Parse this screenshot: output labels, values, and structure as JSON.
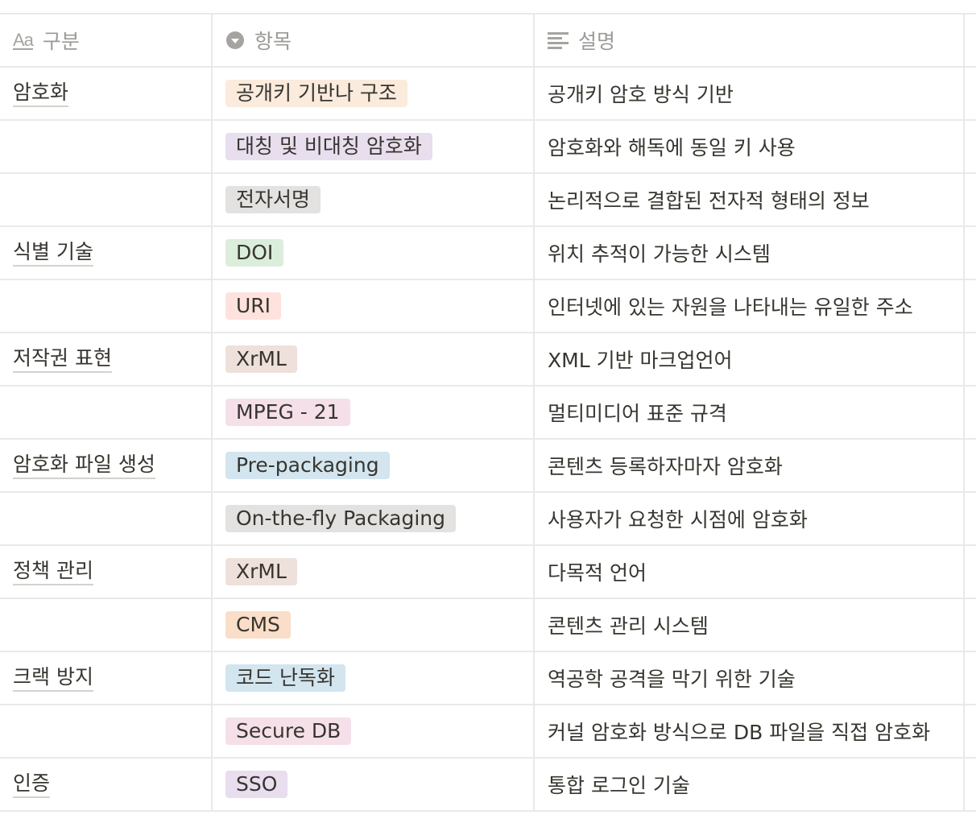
{
  "header": {
    "col_name": "구분",
    "col_item": "항목",
    "col_desc": "설명",
    "col_name_icon": "text-property-icon",
    "col_item_icon": "select-property-icon",
    "col_desc_icon": "paragraph-property-icon"
  },
  "rows": [
    {
      "name": "암호화",
      "tag": "공개키 기반나 구조",
      "tag_color": "#faebdd",
      "desc": "공개키 암호 방식 기반"
    },
    {
      "name": "",
      "tag": "대칭 및 비대칭 암호화",
      "tag_color": "#e8deee",
      "desc": "암호화와 해독에 동일 키 사용"
    },
    {
      "name": "",
      "tag": "전자서명",
      "tag_color": "#e3e2e0",
      "desc": "논리적으로 결합된 전자적 형태의 정보"
    },
    {
      "name": "식별 기술",
      "tag": "DOI",
      "tag_color": "#dbeddb",
      "desc": "위치 추적이 가능한 시스템"
    },
    {
      "name": "",
      "tag": "URI",
      "tag_color": "#ffe2dd",
      "desc": "인터넷에 있는 자원을 나타내는 유일한 주소"
    },
    {
      "name": "저작권 표현",
      "tag": "XrML",
      "tag_color": "#eee0da",
      "desc": "XML 기반 마크업언어"
    },
    {
      "name": "",
      "tag": "MPEG - 21",
      "tag_color": "#f5e0e9",
      "desc": "멀티미디어 표준 규격"
    },
    {
      "name": "암호화 파일 생성",
      "tag": "Pre-packaging",
      "tag_color": "#d3e5ef",
      "desc": "콘텐츠 등록하자마자 암호화"
    },
    {
      "name": "",
      "tag": "On-the-fly Packaging",
      "tag_color": "#e3e2e0",
      "desc": "사용자가 요청한 시점에 암호화"
    },
    {
      "name": "정책 관리",
      "tag": "XrML",
      "tag_color": "#eee0da",
      "desc": "다목적 언어"
    },
    {
      "name": "",
      "tag": "CMS",
      "tag_color": "#fadec9",
      "desc": "콘텐츠 관리 시스템"
    },
    {
      "name": "크랙 방지",
      "tag": "코드 난독화",
      "tag_color": "#d3e5ef",
      "desc": "역공학 공격을 막기 위한 기술"
    },
    {
      "name": "",
      "tag": "Secure DB",
      "tag_color": "#f5e0e9",
      "desc": "커널 암호화 방식으로 DB 파일을 직접 암호화"
    },
    {
      "name": "인증",
      "tag": "SSO",
      "tag_color": "#e8deee",
      "desc": "통합 로그인 기술"
    }
  ]
}
